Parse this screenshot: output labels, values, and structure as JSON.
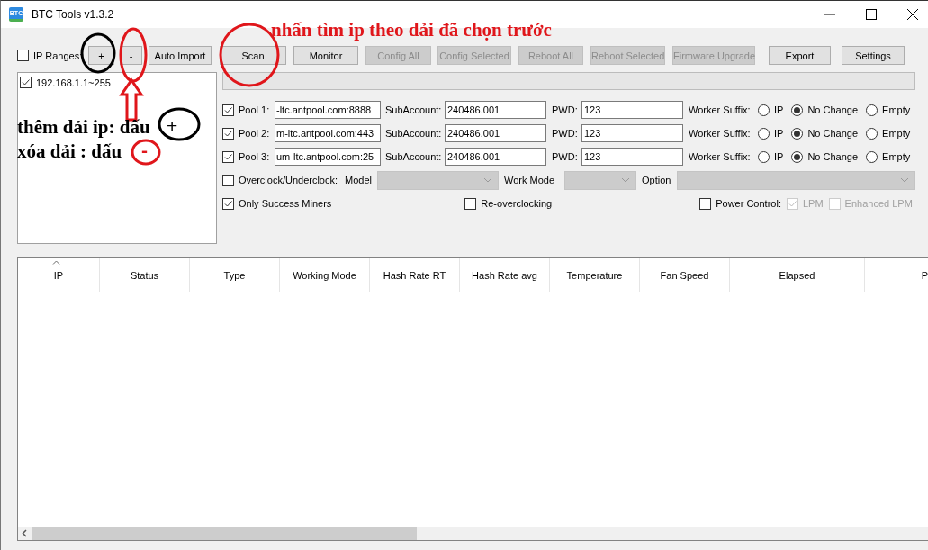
{
  "window": {
    "title": "BTC Tools v1.3.2",
    "icon_text": "BTC"
  },
  "toolbar": {
    "ip_ranges": {
      "label": "IP Ranges:",
      "checked": false
    },
    "buttons": [
      {
        "label": "+",
        "disabled": false
      },
      {
        "label": "-",
        "disabled": false
      },
      {
        "label": "Auto Import",
        "disabled": false
      },
      {
        "label": "Scan",
        "disabled": false
      },
      {
        "label": "Monitor",
        "disabled": false
      },
      {
        "label": "Config All",
        "disabled": true
      },
      {
        "label": "Config Selected",
        "disabled": true
      },
      {
        "label": "Reboot All",
        "disabled": true
      },
      {
        "label": "Reboot Selected",
        "disabled": true
      },
      {
        "label": "Firmware Upgrade",
        "disabled": true
      },
      {
        "label": "Export",
        "disabled": false
      },
      {
        "label": "Settings",
        "disabled": false
      }
    ]
  },
  "ip_list": [
    {
      "label": "192.168.1.1~255",
      "checked": true
    }
  ],
  "pools": [
    {
      "label": "Pool 1:",
      "checked": true,
      "url": "-ltc.antpool.com:8888",
      "sub_label": "SubAccount:",
      "subaccount": "240486.001",
      "pwd_label": "PWD:",
      "pwd": "123",
      "suffix_label": "Worker Suffix:",
      "options": [
        {
          "label": "IP",
          "selected": false
        },
        {
          "label": "No Change",
          "selected": true
        },
        {
          "label": "Empty",
          "selected": false
        }
      ]
    },
    {
      "label": "Pool 2:",
      "checked": true,
      "url": "m-ltc.antpool.com:443",
      "sub_label": "SubAccount:",
      "subaccount": "240486.001",
      "pwd_label": "PWD:",
      "pwd": "123",
      "suffix_label": "Worker Suffix:",
      "options": [
        {
          "label": "IP",
          "selected": false
        },
        {
          "label": "No Change",
          "selected": true
        },
        {
          "label": "Empty",
          "selected": false
        }
      ]
    },
    {
      "label": "Pool 3:",
      "checked": true,
      "url": "um-ltc.antpool.com:25",
      "sub_label": "SubAccount:",
      "subaccount": "240486.001",
      "pwd_label": "PWD:",
      "pwd": "123",
      "suffix_label": "Worker Suffix:",
      "options": [
        {
          "label": "IP",
          "selected": false
        },
        {
          "label": "No Change",
          "selected": true
        },
        {
          "label": "Empty",
          "selected": false
        }
      ]
    }
  ],
  "overclock": {
    "label": "Overclock/Underclock:",
    "checked": false,
    "model_label": "Model",
    "work_mode_label": "Work Mode",
    "option_label": "Option"
  },
  "options_row": [
    {
      "label": "Only Success Miners",
      "checked": true,
      "disabled": false
    },
    {
      "label": "Re-overclocking",
      "checked": false,
      "disabled": false
    },
    {
      "label": "Power Control:",
      "checked": false,
      "disabled": false
    },
    {
      "label": "LPM",
      "checked": true,
      "disabled": true
    },
    {
      "label": "Enhanced LPM",
      "checked": false,
      "disabled": true
    }
  ],
  "table": {
    "columns": [
      "IP",
      "Status",
      "Type",
      "Working Mode",
      "Hash Rate RT",
      "Hash Rate avg",
      "Temperature",
      "Fan Speed",
      "Elapsed",
      "P"
    ]
  },
  "annotations": [
    {
      "text": "nhấn tìm ip theo dải đã chọn trước",
      "color": "#e0161b"
    },
    {
      "text": "thêm dải ip: dấu",
      "color": "#000000"
    },
    {
      "text": "+",
      "color": "#000000"
    },
    {
      "text": "xóa dải : dấu",
      "color": "#000000"
    },
    {
      "text": "-",
      "color": "#e0161b"
    }
  ]
}
